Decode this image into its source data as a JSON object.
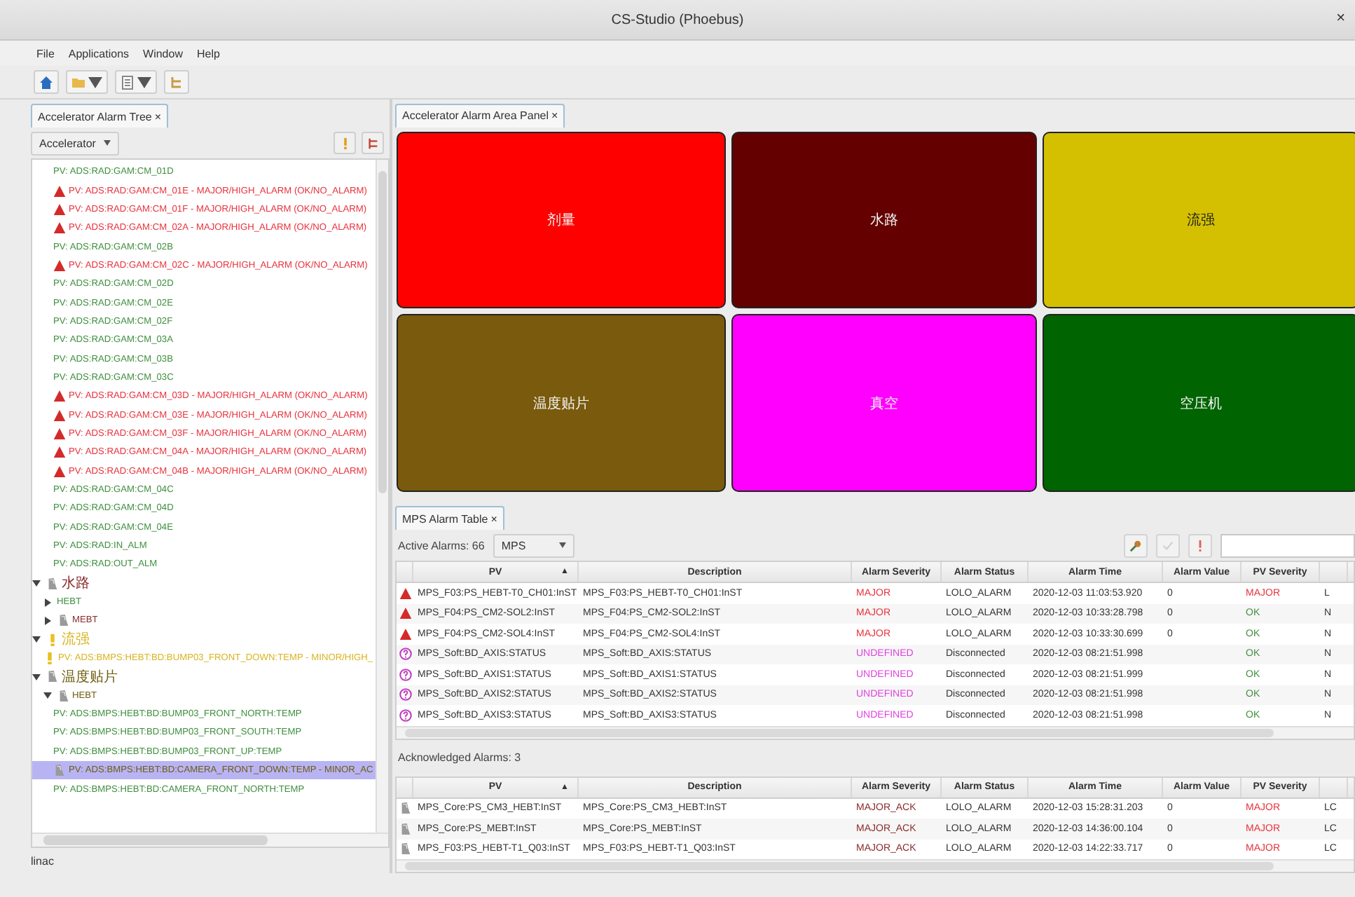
{
  "window": {
    "title": "CS-Studio (Phoebus)",
    "close": "×"
  },
  "menu": [
    "File",
    "Applications",
    "Window",
    "Help"
  ],
  "left_panel": {
    "tab": {
      "label": "Accelerator Alarm Tree",
      "close": "×",
      "selected": true
    },
    "config_dropdown": "Accelerator",
    "tree": {
      "scrolled_items": [
        {
          "label": "PV: ADS:RAD:GAM:CM_01D",
          "kind": "ok",
          "selected": false
        },
        {
          "label": "PV: ADS:RAD:GAM:CM_01E - MAJOR/HIGH_ALARM (OK/NO_ALARM)",
          "kind": "major",
          "selected": false
        },
        {
          "label": "PV: ADS:RAD:GAM:CM_01F - MAJOR/HIGH_ALARM (OK/NO_ALARM)",
          "kind": "major",
          "selected": false
        },
        {
          "label": "PV: ADS:RAD:GAM:CM_02A - MAJOR/HIGH_ALARM (OK/NO_ALARM)",
          "kind": "major",
          "selected": false
        },
        {
          "label": "PV: ADS:RAD:GAM:CM_02B",
          "kind": "ok",
          "selected": false
        },
        {
          "label": "PV: ADS:RAD:GAM:CM_02C - MAJOR/HIGH_ALARM (OK/NO_ALARM)",
          "kind": "major",
          "selected": false
        },
        {
          "label": "PV: ADS:RAD:GAM:CM_02D",
          "kind": "ok",
          "selected": false
        },
        {
          "label": "PV: ADS:RAD:GAM:CM_02E",
          "kind": "ok",
          "selected": false
        },
        {
          "label": "PV: ADS:RAD:GAM:CM_02F",
          "kind": "ok",
          "selected": false
        },
        {
          "label": "PV: ADS:RAD:GAM:CM_03A",
          "kind": "ok",
          "selected": false
        },
        {
          "label": "PV: ADS:RAD:GAM:CM_03B",
          "kind": "ok",
          "selected": false
        },
        {
          "label": "PV: ADS:RAD:GAM:CM_03C",
          "kind": "ok",
          "selected": false
        },
        {
          "label": "PV: ADS:RAD:GAM:CM_03D - MAJOR/HIGH_ALARM (OK/NO_ALARM)",
          "kind": "major",
          "selected": false
        },
        {
          "label": "PV: ADS:RAD:GAM:CM_03E - MAJOR/HIGH_ALARM (OK/NO_ALARM)",
          "kind": "major",
          "selected": false
        },
        {
          "label": "PV: ADS:RAD:GAM:CM_03F - MAJOR/HIGH_ALARM (OK/NO_ALARM)",
          "kind": "major",
          "selected": false
        },
        {
          "label": "PV: ADS:RAD:GAM:CM_04A - MAJOR/HIGH_ALARM (OK/NO_ALARM)",
          "kind": "major",
          "selected": false
        },
        {
          "label": "PV: ADS:RAD:GAM:CM_04B - MAJOR/HIGH_ALARM (OK/NO_ALARM)",
          "kind": "major",
          "selected": false
        },
        {
          "label": "PV: ADS:RAD:GAM:CM_04C",
          "kind": "ok",
          "selected": false
        },
        {
          "label": "PV: ADS:RAD:GAM:CM_04D",
          "kind": "ok",
          "selected": false
        },
        {
          "label": "PV: ADS:RAD:GAM:CM_04E",
          "kind": "ok",
          "selected": false
        },
        {
          "label": "PV: ADS:RAD:IN_ALM",
          "kind": "ok",
          "selected": false
        },
        {
          "label": "PV: ADS:RAD:OUT_ALM",
          "kind": "ok",
          "selected": false
        }
      ],
      "nodes": [
        {
          "label": "水路",
          "kind": "major_ack",
          "expanded": true,
          "selected": false,
          "children": [
            {
              "label": "HEBT",
              "kind": "ok",
              "expanded": false,
              "selected": false
            },
            {
              "label": "MEBT",
              "kind": "major_ack",
              "expanded": false,
              "selected": false
            }
          ]
        },
        {
          "label": "流强",
          "kind": "minor",
          "expanded": true,
          "selected": false,
          "children": [
            {
              "label": "PV: ADS:BMPS:HEBT:BD:BUMP03_FRONT_DOWN:TEMP - MINOR/HIGH_",
              "kind": "minor",
              "selected": false
            }
          ]
        },
        {
          "label": "温度贴片",
          "kind": "minor_ack",
          "expanded": true,
          "selected": false,
          "children": [
            {
              "label": "HEBT",
              "kind": "minor_ack",
              "expanded": true,
              "selected": false,
              "children": [
                {
                  "label": "PV: ADS:BMPS:HEBT:BD:BUMP03_FRONT_NORTH:TEMP",
                  "kind": "ok",
                  "selected": false
                },
                {
                  "label": "PV: ADS:BMPS:HEBT:BD:BUMP03_FRONT_SOUTH:TEMP",
                  "kind": "ok",
                  "selected": false
                },
                {
                  "label": "PV: ADS:BMPS:HEBT:BD:BUMP03_FRONT_UP:TEMP",
                  "kind": "ok",
                  "selected": false
                },
                {
                  "label": "PV: ADS:BMPS:HEBT:BD:CAMERA_FRONT_DOWN:TEMP - MINOR_AC",
                  "kind": "minor_ack",
                  "selected": true
                },
                {
                  "label": "PV: ADS:BMPS:HEBT:BD:CAMERA_FRONT_NORTH:TEMP",
                  "kind": "ok",
                  "selected": false
                }
              ]
            }
          ]
        }
      ]
    },
    "status": "linac"
  },
  "area_panel": {
    "tab": {
      "label": "Accelerator Alarm Area Panel",
      "close": "×",
      "selected": true
    },
    "areas": [
      {
        "label": "剂量",
        "color": "#ff0000"
      },
      {
        "label": "水路",
        "color": "#640000"
      },
      {
        "label": "流强",
        "color": "#d4c000"
      },
      {
        "label": "温度贴片",
        "color": "#7a5a0c"
      },
      {
        "label": "真空",
        "color": "#ff00ff"
      },
      {
        "label": "空压机",
        "color": "#006400"
      }
    ]
  },
  "alarm_table": {
    "tab": {
      "label": "MPS Alarm Table",
      "close": "×",
      "selected": true
    },
    "active_label": "Active Alarms: 66",
    "filter": "MPS",
    "columns": [
      "PV",
      "Description",
      "Alarm Severity",
      "Alarm Status",
      "Alarm Time",
      "Alarm Value",
      "PV Severity"
    ],
    "sort_indicator": "▲",
    "active_rows": [
      {
        "kind": "major",
        "pv": "MPS_F03:PS_HEBT-T0_CH01:InST",
        "description": "MPS_F03:PS_HEBT-T0_CH01:InST",
        "alarm_severity": "MAJOR",
        "alarm_status": "LOLO_ALARM",
        "alarm_time": "2020-12-03 11:03:53.920",
        "alarm_value": "0",
        "pv_severity": {
          "text": "MAJOR",
          "kind": "major"
        },
        "column_8": "L"
      },
      {
        "kind": "major",
        "pv": "MPS_F04:PS_CM2-SOL2:InST",
        "description": "MPS_F04:PS_CM2-SOL2:InST",
        "alarm_severity": "MAJOR",
        "alarm_status": "LOLO_ALARM",
        "alarm_time": "2020-12-03 10:33:28.798",
        "alarm_value": "0",
        "pv_severity": {
          "text": "OK",
          "kind": "ok"
        },
        "column_8": "N"
      },
      {
        "kind": "major",
        "pv": "MPS_F04:PS_CM2-SOL4:InST",
        "description": "MPS_F04:PS_CM2-SOL4:InST",
        "alarm_severity": "MAJOR",
        "alarm_status": "LOLO_ALARM",
        "alarm_time": "2020-12-03 10:33:30.699",
        "alarm_value": "0",
        "pv_severity": {
          "text": "OK",
          "kind": "ok"
        },
        "column_8": "N"
      },
      {
        "kind": "undefined",
        "pv": "MPS_Soft:BD_AXIS:STATUS",
        "description": "MPS_Soft:BD_AXIS:STATUS",
        "alarm_severity": "UNDEFINED",
        "alarm_status": "Disconnected",
        "alarm_time": "2020-12-03 08:21:51.998",
        "pv_severity": {
          "text": "OK",
          "kind": "ok"
        },
        "column_8": "N"
      },
      {
        "kind": "undefined",
        "pv": "MPS_Soft:BD_AXIS1:STATUS",
        "description": "MPS_Soft:BD_AXIS1:STATUS",
        "alarm_severity": "UNDEFINED",
        "alarm_status": "Disconnected",
        "alarm_time": "2020-12-03 08:21:51.999",
        "pv_severity": {
          "text": "OK",
          "kind": "ok"
        },
        "column_8": "N"
      },
      {
        "kind": "undefined",
        "pv": "MPS_Soft:BD_AXIS2:STATUS",
        "description": "MPS_Soft:BD_AXIS2:STATUS",
        "alarm_severity": "UNDEFINED",
        "alarm_status": "Disconnected",
        "alarm_time": "2020-12-03 08:21:51.998",
        "pv_severity": {
          "text": "OK",
          "kind": "ok"
        },
        "column_8": "N"
      },
      {
        "kind": "undefined",
        "pv": "MPS_Soft:BD_AXIS3:STATUS",
        "description": "MPS_Soft:BD_AXIS3:STATUS",
        "alarm_severity": "UNDEFINED",
        "alarm_status": "Disconnected",
        "alarm_time": "2020-12-03 08:21:51.998",
        "pv_severity": {
          "text": "OK",
          "kind": "ok"
        },
        "column_8": "N"
      }
    ],
    "acknowledged_label": "Acknowledged Alarms: 3",
    "acknowledged_columns": [
      "PV",
      "Description",
      "Alarm Severity",
      "Alarm Status",
      "Alarm Time",
      "Alarm Value",
      "PV Severity"
    ],
    "acknowledged_sort_indicator": "▲",
    "acknowledged_rows": [
      {
        "kind": "major_ack",
        "pv": "MPS_Core:PS_CM3_HEBT:InST",
        "description": "MPS_Core:PS_CM3_HEBT:InST",
        "alarm_severity": "MAJOR_ACK",
        "alarm_status": "LOLO_ALARM",
        "alarm_time": "2020-12-03 15:28:31.203",
        "alarm_value": "0",
        "pv_severity": {
          "text": "MAJOR",
          "kind": "major"
        },
        "column_8": "LC"
      },
      {
        "kind": "major_ack",
        "pv": "MPS_Core:PS_MEBT:InST",
        "description": "MPS_Core:PS_MEBT:InST",
        "alarm_severity": "MAJOR_ACK",
        "alarm_status": "LOLO_ALARM",
        "alarm_time": "2020-12-03 14:36:00.104",
        "alarm_value": "0",
        "pv_severity": {
          "text": "MAJOR",
          "kind": "major"
        },
        "column_8": "LC"
      },
      {
        "kind": "major_ack",
        "pv": "MPS_F03:PS_HEBT-T1_Q03:InST",
        "description": "MPS_F03:PS_HEBT-T1_Q03:InST",
        "alarm_severity": "MAJOR_ACK",
        "alarm_status": "LOLO_ALARM",
        "alarm_time": "2020-12-03 14:22:33.717",
        "alarm_value": "0",
        "pv_severity": {
          "text": "MAJOR",
          "kind": "major"
        },
        "column_8": "LC"
      }
    ]
  }
}
